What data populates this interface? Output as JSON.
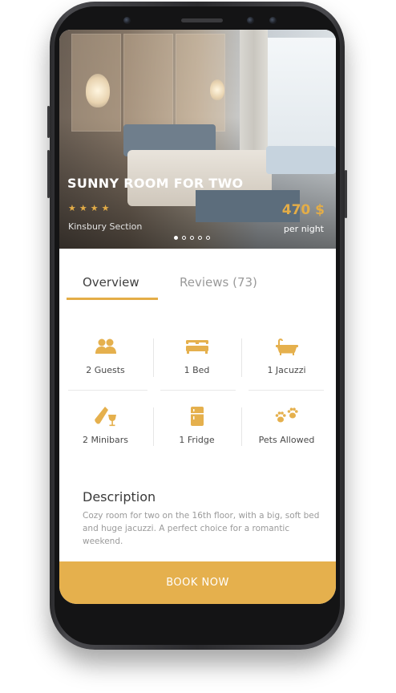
{
  "hero": {
    "title": "SUNNY ROOM FOR TWO",
    "rating_stars": 4,
    "stars_text": "★★★★",
    "section": "Kinsbury Section",
    "price": "470 $",
    "price_unit": "per night",
    "carousel": {
      "total": 5,
      "active_index": 0
    }
  },
  "tabs": [
    {
      "label": "Overview",
      "active": true
    },
    {
      "label": "Reviews (73)",
      "active": false
    }
  ],
  "amenities": [
    {
      "icon": "guests-icon",
      "label": "2 Guests"
    },
    {
      "icon": "bed-icon",
      "label": "1 Bed"
    },
    {
      "icon": "bathtub-icon",
      "label": "1 Jacuzzi"
    },
    {
      "icon": "minibar-icon",
      "label": "2 Minibars"
    },
    {
      "icon": "fridge-icon",
      "label": "1 Fridge"
    },
    {
      "icon": "paw-icon",
      "label": "Pets Allowed"
    }
  ],
  "description": {
    "title": "Description",
    "text": "Cozy room for two on the 16th floor, with a big, soft bed and huge jacuzzi. A perfect choice for a romantic weekend."
  },
  "cta": {
    "label": "BOOK NOW"
  },
  "colors": {
    "accent": "#e5b04d",
    "text_dark": "#3f3f3f",
    "text_muted": "#9a9a9a"
  }
}
